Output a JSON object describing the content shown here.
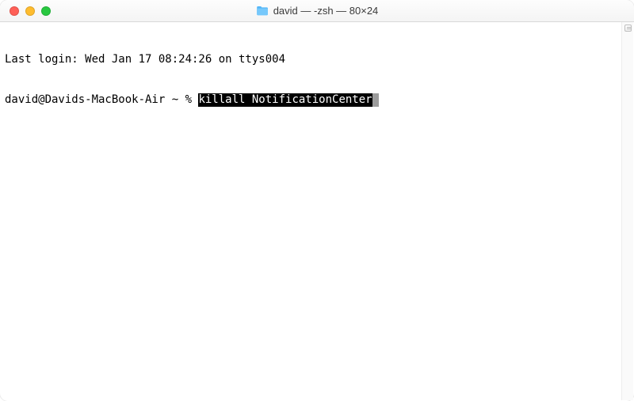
{
  "titlebar": {
    "folder_icon_name": "folder-icon",
    "title": "david — -zsh — 80×24"
  },
  "terminal": {
    "last_login_line": "Last login: Wed Jan 17 08:24:26 on ttys004",
    "prompt": "david@Davids-MacBook-Air ~ % ",
    "command": "killall NotificationCenter"
  }
}
